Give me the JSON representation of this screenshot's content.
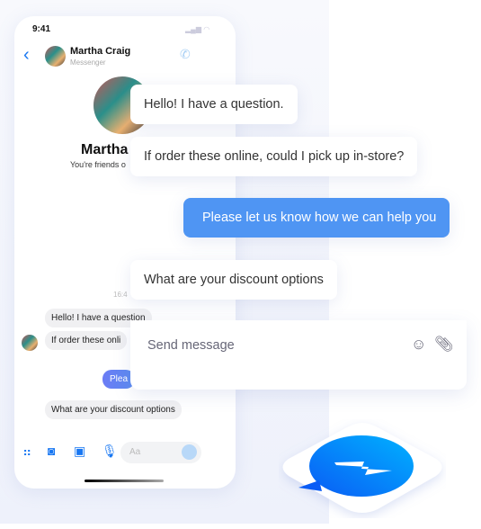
{
  "status_bar": {
    "time": "9:41",
    "signal": "▂▄▆ ◠"
  },
  "header": {
    "back_icon": "chevron-left",
    "name": "Martha Craig",
    "subtitle": "Messenger",
    "call_icon": "phone"
  },
  "profile": {
    "name": "Martha",
    "friends_text": "You're friends o"
  },
  "chat": {
    "timestamp": "16:4",
    "messages": [
      {
        "text": "Hello! I have a question",
        "from": "them"
      },
      {
        "text": "If order these onli",
        "from": "them"
      },
      {
        "text": "Plea",
        "from": "me"
      },
      {
        "text": "What are your discount options",
        "from": "them"
      }
    ]
  },
  "composer": {
    "placeholder": "Aa",
    "icons": [
      "menu-dots",
      "camera",
      "image",
      "microphone",
      "emoji"
    ]
  },
  "overlay": {
    "bubbles": [
      {
        "text": "Hello! I have a question.",
        "from": "them"
      },
      {
        "text": "If order these online, could I pick up in-store?",
        "from": "them"
      },
      {
        "text": "Please let us know how we can help you",
        "from": "me"
      },
      {
        "text": "What are your discount options",
        "from": "them"
      }
    ],
    "send_placeholder": "Send message",
    "accent": "#4f95f3"
  },
  "logo": {
    "name": "messenger-logo"
  }
}
